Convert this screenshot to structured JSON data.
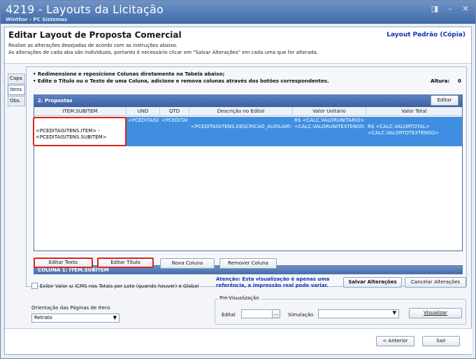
{
  "window": {
    "title": "4219 - Layouts da Licitação",
    "subtitle": "Winthor - PC Sistemas",
    "controls": [
      "◨",
      "–",
      "✕"
    ]
  },
  "header": {
    "title": "Editar Layout de Proposta Comercial",
    "layout_name": "Layout Padrão (Cópia)",
    "instruction1": "Realize as alterações desejadas de acordo com as instruções abaixo.",
    "instruction2": "As alterações de cada aba são individuais, portanto é necessário clicar em \"Salvar Alterações\" em cada uma que for alterada."
  },
  "tabs": [
    {
      "label": "Capa"
    },
    {
      "label": "Itens"
    },
    {
      "label": "Obs."
    }
  ],
  "main": {
    "bullet1": "• Redimensione e reposicione Colunas diretamente na Tabela abaixo;",
    "bullet2": "• Edite o Título ou o Texto de uma Coluna, adicione e remova colunas  através dos botões correspondentes.",
    "altura_label": "Altura:",
    "altura_value": "0"
  },
  "grid": {
    "title": "2. Propostas",
    "edit_button": "Editar",
    "columns": [
      "ITEM.SUBITEM",
      "UND",
      "QTD",
      "Descrição no Edital",
      "Valor Unitário",
      "Valor Total"
    ],
    "row": [
      "<PCEDITAISITENS.ITEM> - <PCEDITAISITENS.SUBITEM>",
      "<PCEDITAISITENS.CODUNIDADE>",
      "<PCEDITAISITENS.QUANTIDADE>",
      "<PCEDITAISITENS.DESCRICAO_AUXILIAR>",
      "R$ <CALC.VALORUNITARIO> <CALC.VALORUNITEXTENSO>",
      "R$ <CALC.VALORTOTAL> <CALC.VALORTOTEXTENSO>"
    ]
  },
  "column_section": {
    "label": "COLUNA 1: ITEM.SUBITEM",
    "buttons": {
      "edit_text": "Editar Texto",
      "edit_title": "Editar Título",
      "new_column": "Nova Coluna",
      "remove_column": "Remover Coluna"
    }
  },
  "options": {
    "checkbox_label": "Exibir Valor s/ ICMS nos Totais por Lote (quando houver) e Global",
    "attention": "Atenção: Esta visualização é apenas uma referência, a impressão real pode variar.",
    "save_button": "Salvar Alterações",
    "cancel_button": "Cancelar Alterações",
    "orientation_label": "Orientação das Páginas de Itens",
    "orientation_value": "Retrato"
  },
  "preview": {
    "legend": "Pré-Visualização",
    "edital_label": "Edital",
    "simulacao_label": "Simulação",
    "visualize_button": "Visualizar"
  },
  "footer": {
    "back_button": "< Anterior",
    "exit_button": "Sair"
  }
}
